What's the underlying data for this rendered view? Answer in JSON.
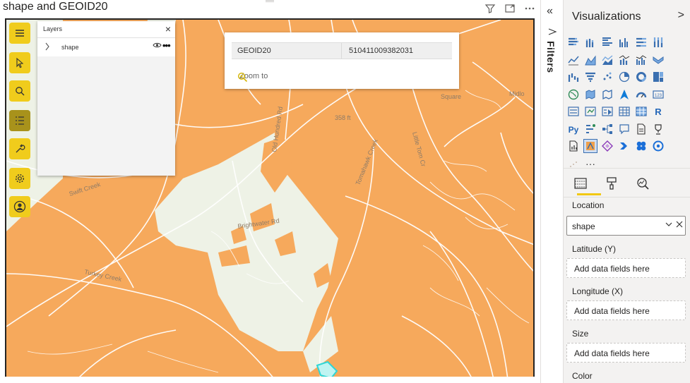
{
  "visual": {
    "title": "shape and GEOID20",
    "header_icons": [
      "filter-icon",
      "focus-mode-icon",
      "more-options-icon"
    ]
  },
  "map": {
    "colors": {
      "fill": "#f6a95c",
      "base": "#eef2e6",
      "roads": "#ffffff",
      "highlight": "#7fe0e0"
    },
    "labels": {
      "swift_creek": "Swift Creek",
      "turkey_creek": "Turkey Creek",
      "tomahawk_creek": "Tomahawk Creek",
      "little_tomahawk": "Little Tom Cr",
      "elevation": "358 ft",
      "midlothian": "Midlo",
      "road_a": "Old Hundred Rd",
      "road_b": "Brightwater Rd",
      "square": "Square"
    },
    "tools": [
      "menu-icon",
      "select-icon",
      "search-icon",
      "legend-icon",
      "wrench-icon",
      "settings-icon",
      "user-icon"
    ],
    "active_tool": "legend-icon"
  },
  "layers_panel": {
    "title": "Layers",
    "close_glyph": "×",
    "layer_name": "shape",
    "eye_glyph": "👁",
    "more_glyph": "•••"
  },
  "popup": {
    "field": "GEOID20",
    "value": "510411009382031",
    "zoom_label": "Zoom to"
  },
  "filters": {
    "label": "Filters",
    "collapse_glyph": "«",
    "funnel_glyph": "⊲"
  },
  "visualizations": {
    "title": "Visualizations",
    "collapse_glyph": ">",
    "more_glyph": "···",
    "tab_names": [
      "build-visual-icon",
      "format-visual-icon",
      "analytics-icon"
    ],
    "wells": {
      "location_label": "Location",
      "location_value": "shape",
      "latitude_label": "Latitude (Y)",
      "latitude_placeholder": "Add data fields here",
      "longitude_label": "Longitude (X)",
      "longitude_placeholder": "Add data fields here",
      "size_label": "Size",
      "size_placeholder": "Add data fields here",
      "color_label": "Color"
    }
  }
}
